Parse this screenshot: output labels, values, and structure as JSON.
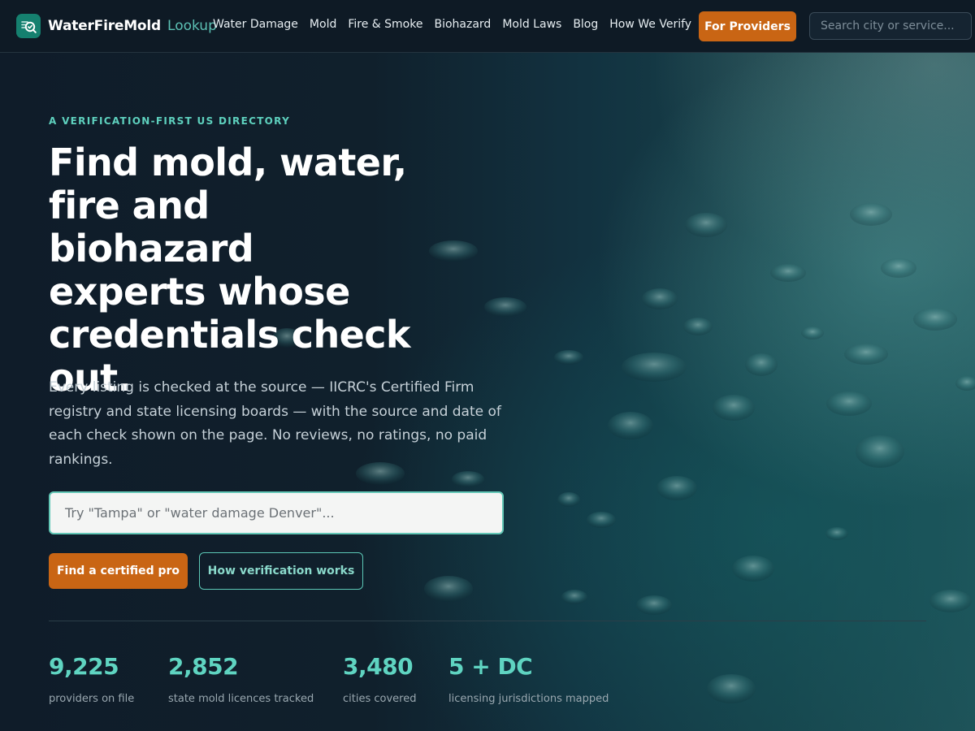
{
  "brand": {
    "name": "WaterFireMold",
    "suffix": "Lookup",
    "logo_icon": "shield-check-icon",
    "accent_color": "#5ed1be",
    "cta_color": "#c96514"
  },
  "nav": {
    "items": [
      "Water Damage",
      "Mold",
      "Fire & Smoke",
      "Biohazard",
      "Mold Laws",
      "Blog",
      "How We Verify"
    ],
    "providers_label": "For Providers",
    "search_placeholder": "Search city or service..."
  },
  "hero": {
    "eyebrow": "A VERIFICATION-FIRST US DIRECTORY",
    "headline": "Find mold, water, fire and biohazard experts whose credentials check out.",
    "lead": "Every listing is checked at the source — IICRC's Certified Firm registry and state licensing boards — with the source and date of each check shown on the page. No reviews, no ratings, no paid rankings.",
    "search_placeholder": "Try \"Tampa\" or \"water damage Denver\"...",
    "primary_cta": "Find a certified pro",
    "secondary_cta": "How verification works"
  },
  "stats": [
    {
      "value": "9,225",
      "label": "providers on file"
    },
    {
      "value": "2,852",
      "label": "state mold licences tracked"
    },
    {
      "value": "3,480",
      "label": "cities covered"
    },
    {
      "value": "5 + DC",
      "label": "licensing jurisdictions mapped"
    }
  ]
}
